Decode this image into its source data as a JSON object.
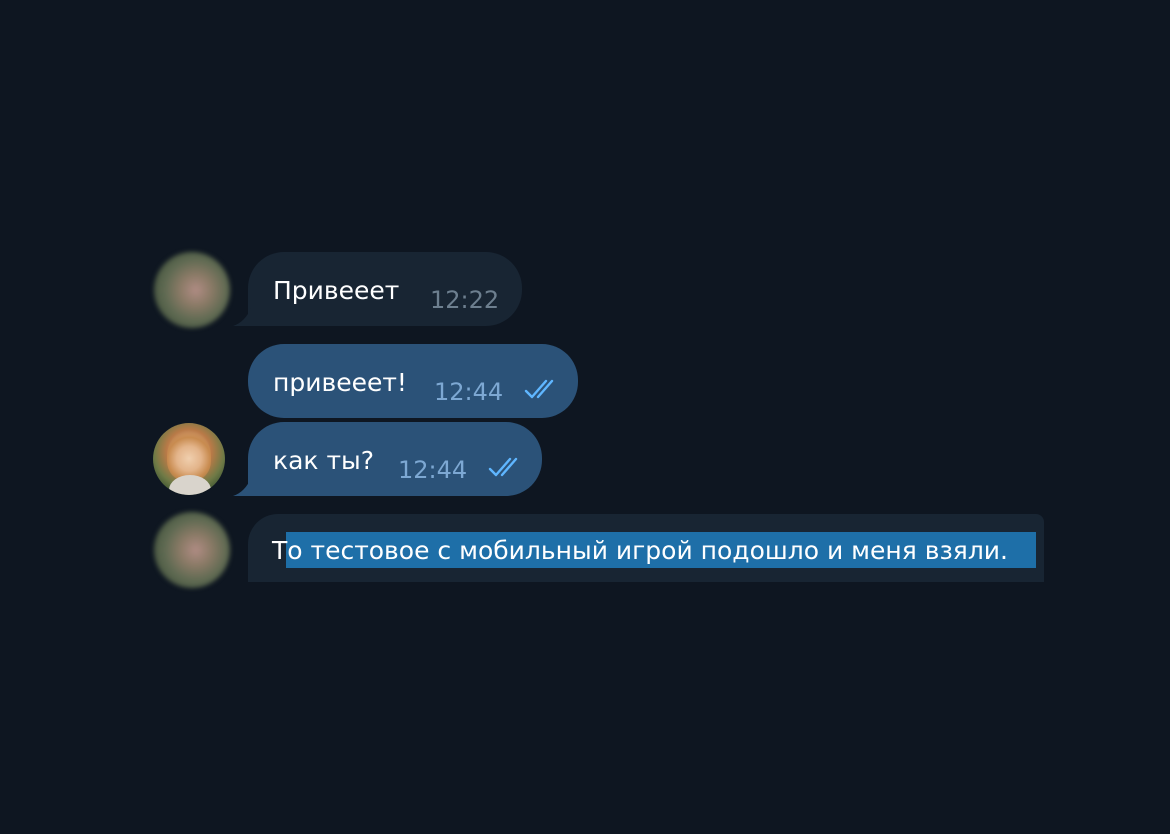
{
  "messages": [
    {
      "text": "Привееет",
      "time": "12:22"
    },
    {
      "text": "привееет!",
      "time": "12:44"
    },
    {
      "text": "как ты?",
      "time": "12:44"
    },
    {
      "text": "То тестовое с мобильный игрой подошло и меня взяли."
    }
  ],
  "colors": {
    "background": "#0e1621",
    "incoming_bubble": "#182533",
    "outgoing_bubble": "#2b5278",
    "selection": "#1e6fa8",
    "read_checks": "#5fb6ff"
  },
  "icons": {
    "read_status": "double-check-icon"
  }
}
